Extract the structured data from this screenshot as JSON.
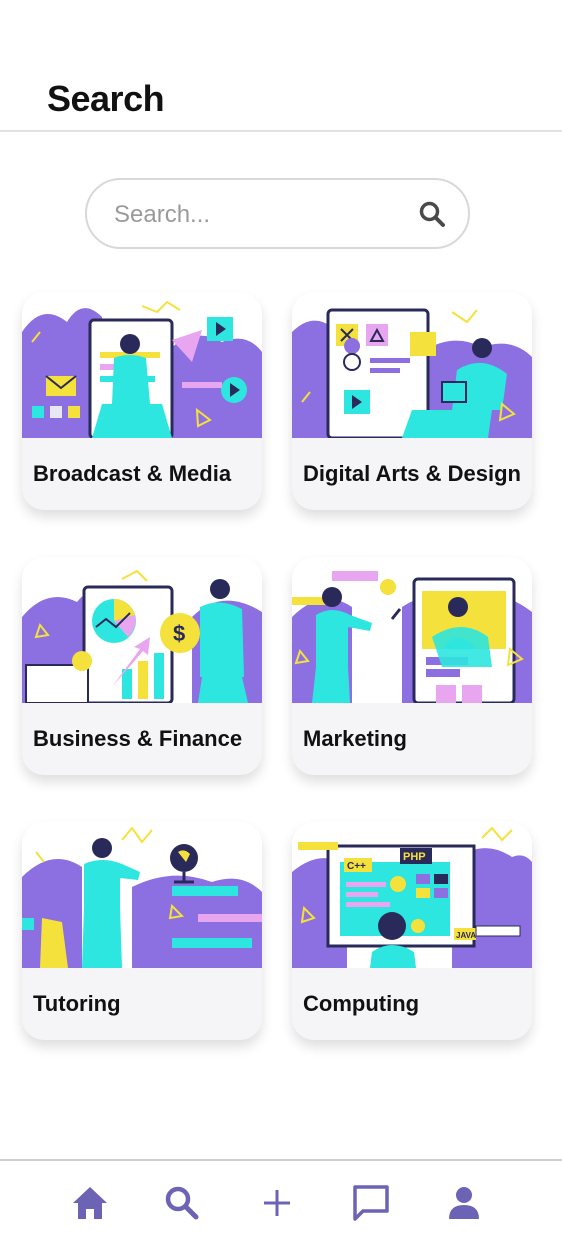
{
  "header": {
    "title": "Search"
  },
  "search": {
    "placeholder": "Search..."
  },
  "categories": [
    {
      "label": "Broadcast & Media",
      "illustration": "broadcast-media-illustration"
    },
    {
      "label": "Digital Arts & Design",
      "illustration": "digital-arts-illustration"
    },
    {
      "label": "Business & Finance",
      "illustration": "business-finance-illustration"
    },
    {
      "label": "Marketing",
      "illustration": "marketing-illustration"
    },
    {
      "label": "Tutoring",
      "illustration": "tutoring-illustration"
    },
    {
      "label": "Computing",
      "illustration": "computing-illustration"
    }
  ],
  "illustration_text": {
    "cpp": "C++",
    "php": "PHP",
    "java": "JAVA"
  },
  "bottom_nav": [
    {
      "icon": "home-icon"
    },
    {
      "icon": "search-icon",
      "active": true
    },
    {
      "icon": "plus-icon"
    },
    {
      "icon": "chat-icon"
    },
    {
      "icon": "profile-icon"
    }
  ],
  "colors": {
    "purple": "#8c6fe0",
    "cyan": "#2de6df",
    "yellow": "#f5e13b",
    "navy": "#2a2a5a",
    "nav_icon": "#6c63b5"
  }
}
